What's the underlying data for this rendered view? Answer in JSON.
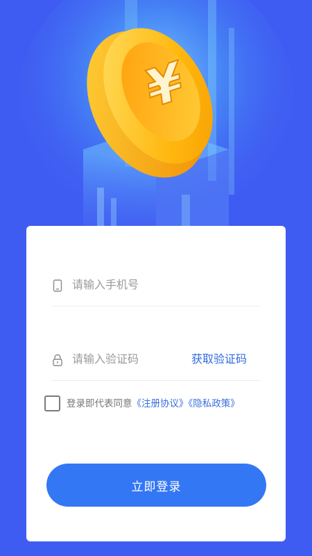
{
  "hero": {
    "coin_symbol": "¥",
    "coin_icon": "yen-coin-icon"
  },
  "form": {
    "phone_placeholder": "请输入手机号",
    "code_placeholder": "请输入验证码",
    "get_code_label": "获取验证码",
    "phone_icon": "phone-icon",
    "lock_icon": "lock-icon"
  },
  "agreement": {
    "prefix": "登录即代表同意",
    "register_link": "《注册协议》",
    "privacy_link": "《隐私政策》",
    "checked": false
  },
  "login_button_label": "立即登录",
  "colors": {
    "background": "#3f5cf2",
    "accent": "#3477f5",
    "link": "#3a6fe0",
    "coin_gold": "#ffb20a"
  }
}
